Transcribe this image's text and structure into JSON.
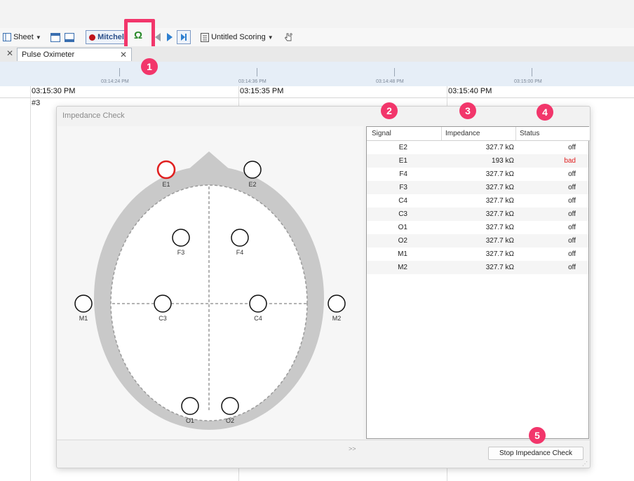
{
  "toolbar": {
    "sheet_label": "Sheet",
    "patient_label": "Mitchel",
    "omega_symbol": "Ω",
    "scoring_label": "Untitled Scoring"
  },
  "tabs": [
    {
      "label": "Pulse Oximeter"
    }
  ],
  "timeline": {
    "overview_ticks": [
      "03:14:24 PM",
      "03:14:36 PM",
      "03:14:48 PM",
      "03:15:00 PM"
    ],
    "main_ticks": [
      "03:15:30 PM",
      "03:15:35 PM",
      "03:15:40 PM"
    ],
    "epoch_label": "#3"
  },
  "dialog": {
    "title": "Impedance Check",
    "columns": [
      "Signal",
      "Impedance",
      "Status"
    ],
    "rows": [
      {
        "signal": "E2",
        "impedance": "327.7 kΩ",
        "status": "off"
      },
      {
        "signal": "E1",
        "impedance": "193 kΩ",
        "status": "bad"
      },
      {
        "signal": "F4",
        "impedance": "327.7 kΩ",
        "status": "off"
      },
      {
        "signal": "F3",
        "impedance": "327.7 kΩ",
        "status": "off"
      },
      {
        "signal": "C4",
        "impedance": "327.7 kΩ",
        "status": "off"
      },
      {
        "signal": "C3",
        "impedance": "327.7 kΩ",
        "status": "off"
      },
      {
        "signal": "O1",
        "impedance": "327.7 kΩ",
        "status": "off"
      },
      {
        "signal": "O2",
        "impedance": "327.7 kΩ",
        "status": "off"
      },
      {
        "signal": "M1",
        "impedance": "327.7 kΩ",
        "status": "off"
      },
      {
        "signal": "M2",
        "impedance": "327.7 kΩ",
        "status": "off"
      }
    ],
    "electrodes": [
      {
        "name": "E1",
        "status": "bad"
      },
      {
        "name": "E2",
        "status": "off"
      },
      {
        "name": "F3",
        "status": "off"
      },
      {
        "name": "F4",
        "status": "off"
      },
      {
        "name": "M1",
        "status": "off"
      },
      {
        "name": "C3",
        "status": "off"
      },
      {
        "name": "C4",
        "status": "off"
      },
      {
        "name": "M2",
        "status": "off"
      },
      {
        "name": "O1",
        "status": "off"
      },
      {
        "name": "O2",
        "status": "off"
      }
    ],
    "expand_label": ">>",
    "stop_button": "Stop Impedance Check"
  },
  "badges": [
    "1",
    "2",
    "3",
    "4",
    "5"
  ],
  "colors": {
    "badge": "#f2366b",
    "bad": "#e02020",
    "record_dot": "#c0141c",
    "head_fill": "#c9c9c9"
  }
}
